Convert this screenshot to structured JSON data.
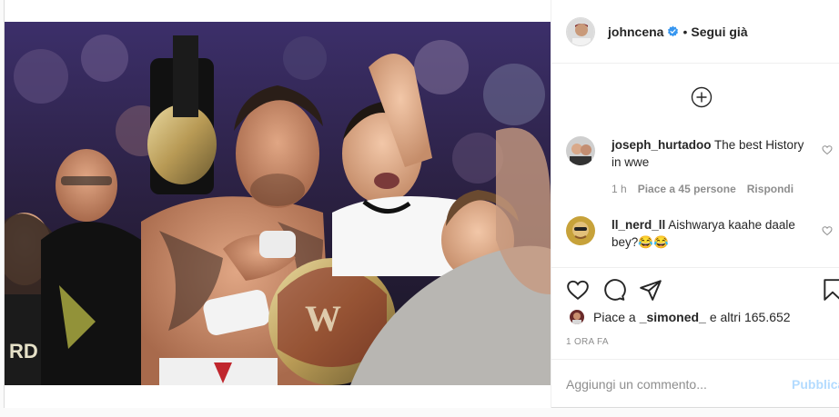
{
  "header": {
    "username": "johncena",
    "separator": "•",
    "follow_label": "Segui già"
  },
  "comments": [
    {
      "user": "joseph_hurtadoo",
      "text": "The best History in wwe",
      "time": "1 h",
      "likes": "Piace a 45 persone",
      "reply": "Rispondi"
    },
    {
      "user": "ll_nerd_ll",
      "text": "Aishwarya kaahe daale bey?😂😂"
    }
  ],
  "likes": {
    "prefix": "Piace a",
    "user": "_simoned_",
    "suffix": "e altri 165.652"
  },
  "time_ago": "1 ORA FA",
  "add_comment": {
    "placeholder": "Aggiungi un commento...",
    "publish_label": "Pubblica"
  },
  "icons": [
    "verified-badge-icon",
    "add-icon",
    "heart-icon",
    "comment-icon",
    "share-icon",
    "bookmark-icon"
  ],
  "colors": {
    "verified": "#3897f0",
    "publish_disabled": "#b3dbff",
    "muted": "#8e8e8e"
  }
}
